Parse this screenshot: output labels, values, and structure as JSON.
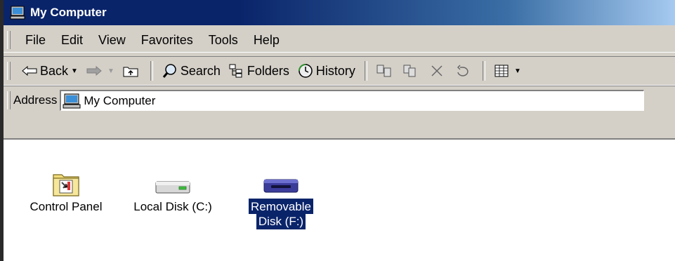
{
  "window": {
    "title": "My Computer",
    "title_icon": "my-computer-icon",
    "colors": {
      "title_bar_start": "#0a246a",
      "title_bar_end": "#a6caf0",
      "face": "#d4d0c8",
      "selection": "#0a246a"
    }
  },
  "menu": {
    "items": [
      "File",
      "Edit",
      "View",
      "Favorites",
      "Tools",
      "Help"
    ]
  },
  "toolbar": {
    "back_label": "Back",
    "search_label": "Search",
    "folders_label": "Folders",
    "history_label": "History",
    "icons": [
      "back-arrow-icon",
      "forward-arrow-icon",
      "up-folder-icon",
      "search-icon",
      "folders-icon",
      "history-icon",
      "move-to-icon",
      "copy-to-icon",
      "delete-icon",
      "undo-icon",
      "views-icon"
    ]
  },
  "address": {
    "label": "Address",
    "value": "My Computer"
  },
  "items": [
    {
      "label": "Control Panel",
      "icon": "control-panel-icon",
      "selected": false
    },
    {
      "label": "Local Disk (C:)",
      "icon": "hard-disk-icon",
      "selected": false
    },
    {
      "label": "Removable Disk (F:)",
      "label_lines": [
        "Removable",
        "Disk (F:)"
      ],
      "icon": "removable-disk-icon",
      "selected": true
    }
  ]
}
